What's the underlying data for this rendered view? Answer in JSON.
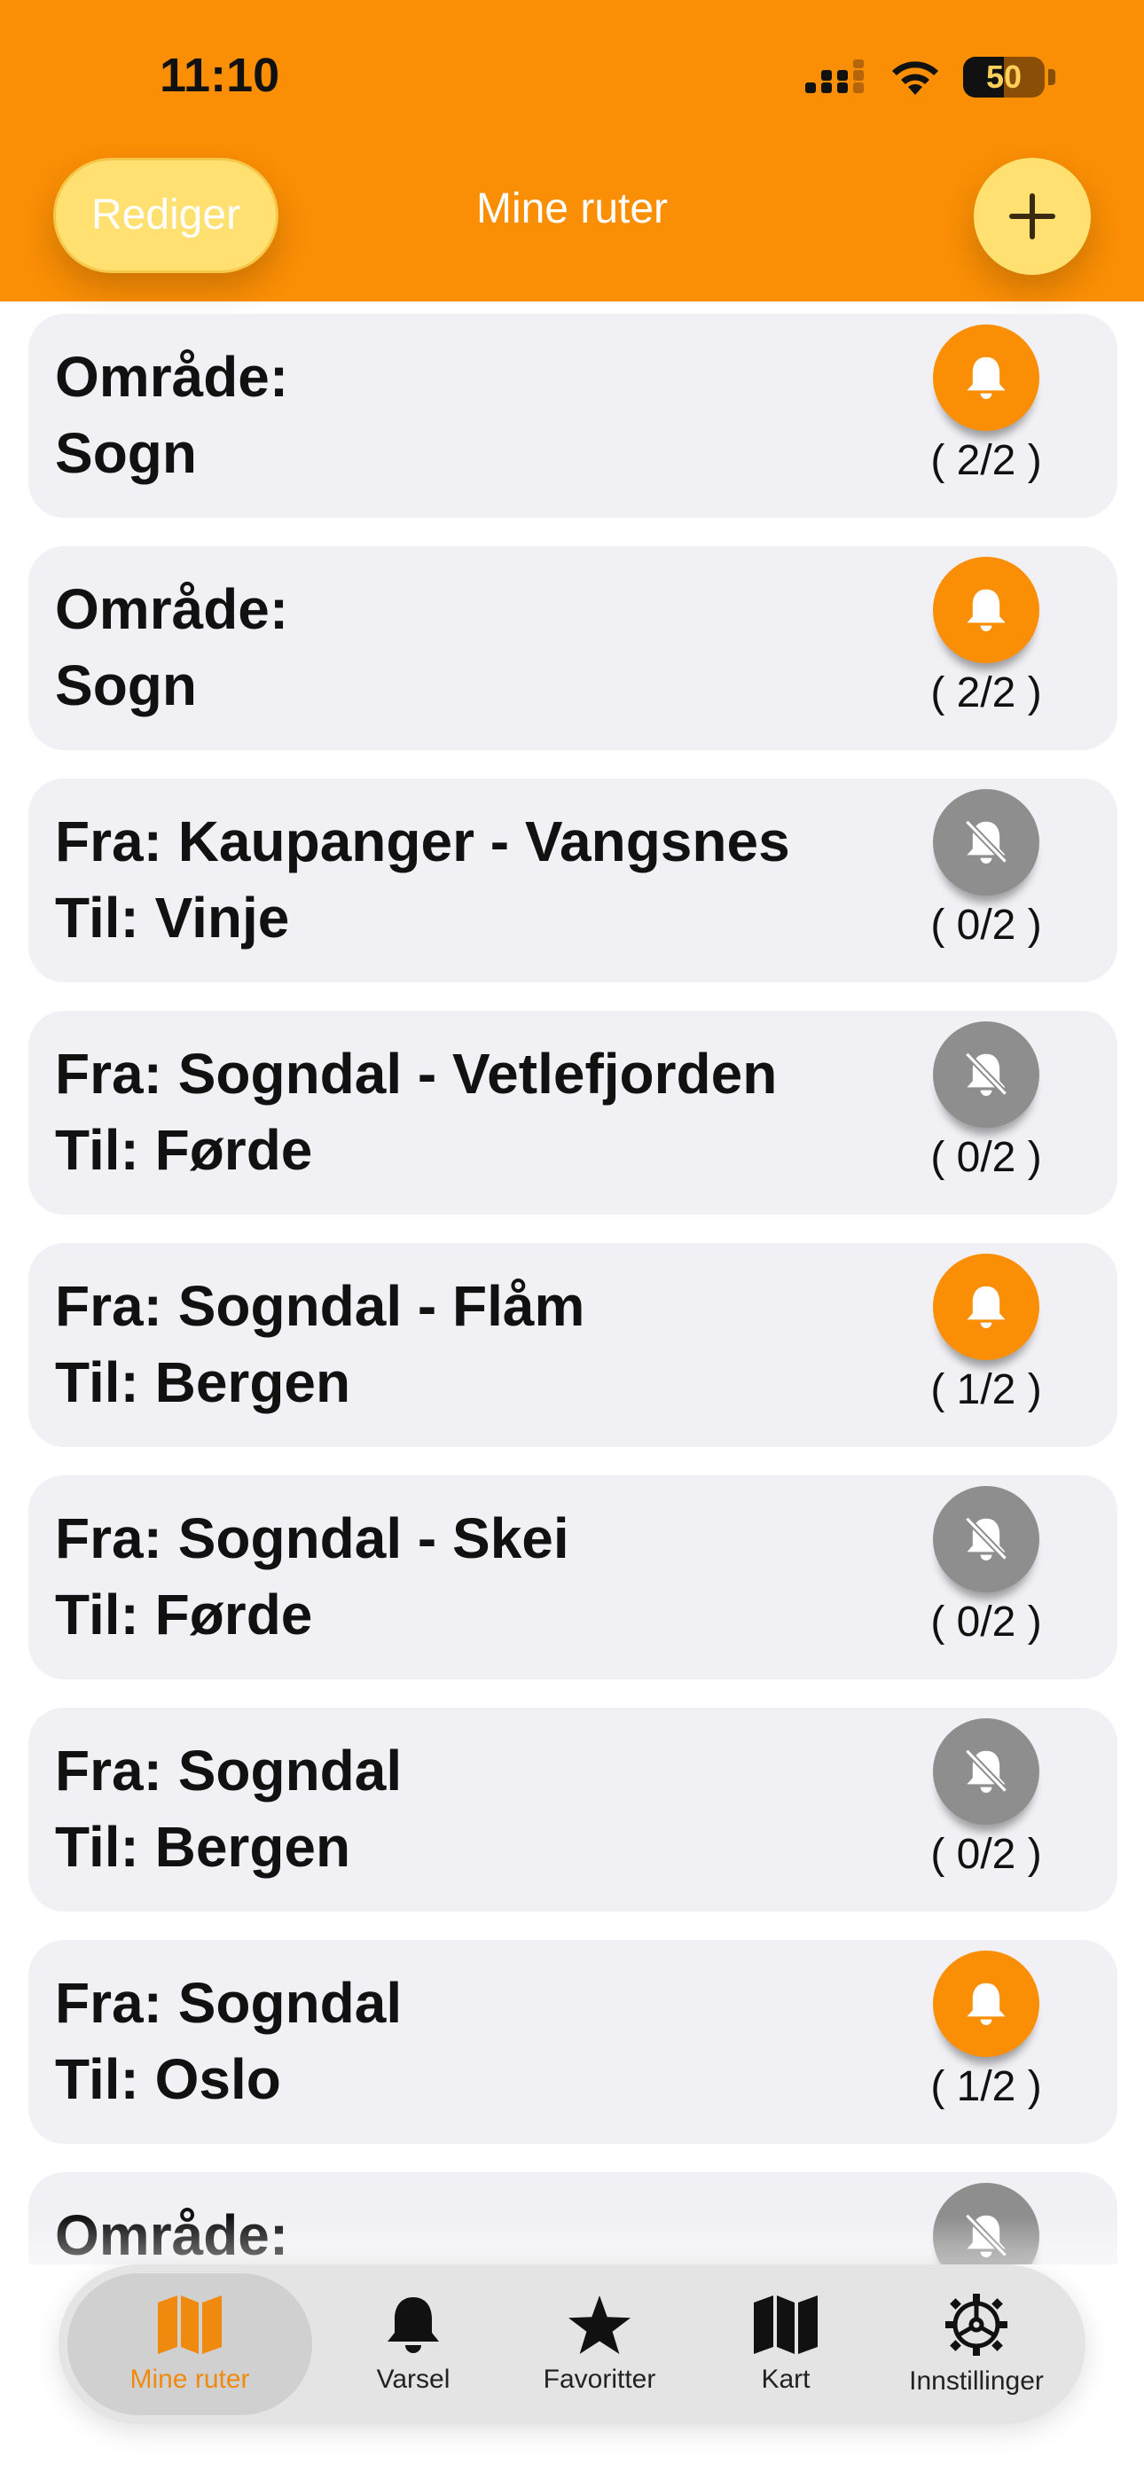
{
  "status_bar": {
    "time": "11:10",
    "battery": "50"
  },
  "header": {
    "edit_label": "Rediger",
    "title": "Mine ruter",
    "add_icon": "plus-icon"
  },
  "colors": {
    "accent": "#FA8E05",
    "bell_off": "#8E8E8E",
    "card_bg": "#F1F1F5"
  },
  "routes": [
    {
      "line1": "Område:",
      "line2": "Sogn",
      "count": "( 2/2 )",
      "alert": "on"
    },
    {
      "line1": "Område:",
      "line2": "Sogn",
      "count": "( 2/2 )",
      "alert": "on"
    },
    {
      "line1": "Fra: Kaupanger - Vangsnes",
      "line2": "Til: Vinje",
      "count": "( 0/2 )",
      "alert": "off"
    },
    {
      "line1": "Fra: Sogndal - Vetlefjorden",
      "line2": "Til: Førde",
      "count": "( 0/2 )",
      "alert": "off"
    },
    {
      "line1": "Fra: Sogndal - Flåm",
      "line2": "Til: Bergen",
      "count": "( 1/2 )",
      "alert": "on"
    },
    {
      "line1": "Fra: Sogndal - Skei",
      "line2": "Til: Førde",
      "count": "( 0/2 )",
      "alert": "off"
    },
    {
      "line1": "Fra: Sogndal",
      "line2": "Til: Bergen",
      "count": "( 0/2 )",
      "alert": "off"
    },
    {
      "line1": "Fra: Sogndal",
      "line2": "Til: Oslo",
      "count": "( 1/2 )",
      "alert": "on"
    },
    {
      "line1": "Område:",
      "line2": "",
      "count": "",
      "alert": "off"
    }
  ],
  "tabs": [
    {
      "label": "Mine ruter",
      "icon": "map-icon",
      "active": true
    },
    {
      "label": "Varsel",
      "icon": "bell-icon",
      "active": false
    },
    {
      "label": "Favoritter",
      "icon": "star-icon",
      "active": false
    },
    {
      "label": "Kart",
      "icon": "map-icon",
      "active": false
    },
    {
      "label": "Innstillinger",
      "icon": "gear-icon",
      "active": false
    }
  ]
}
